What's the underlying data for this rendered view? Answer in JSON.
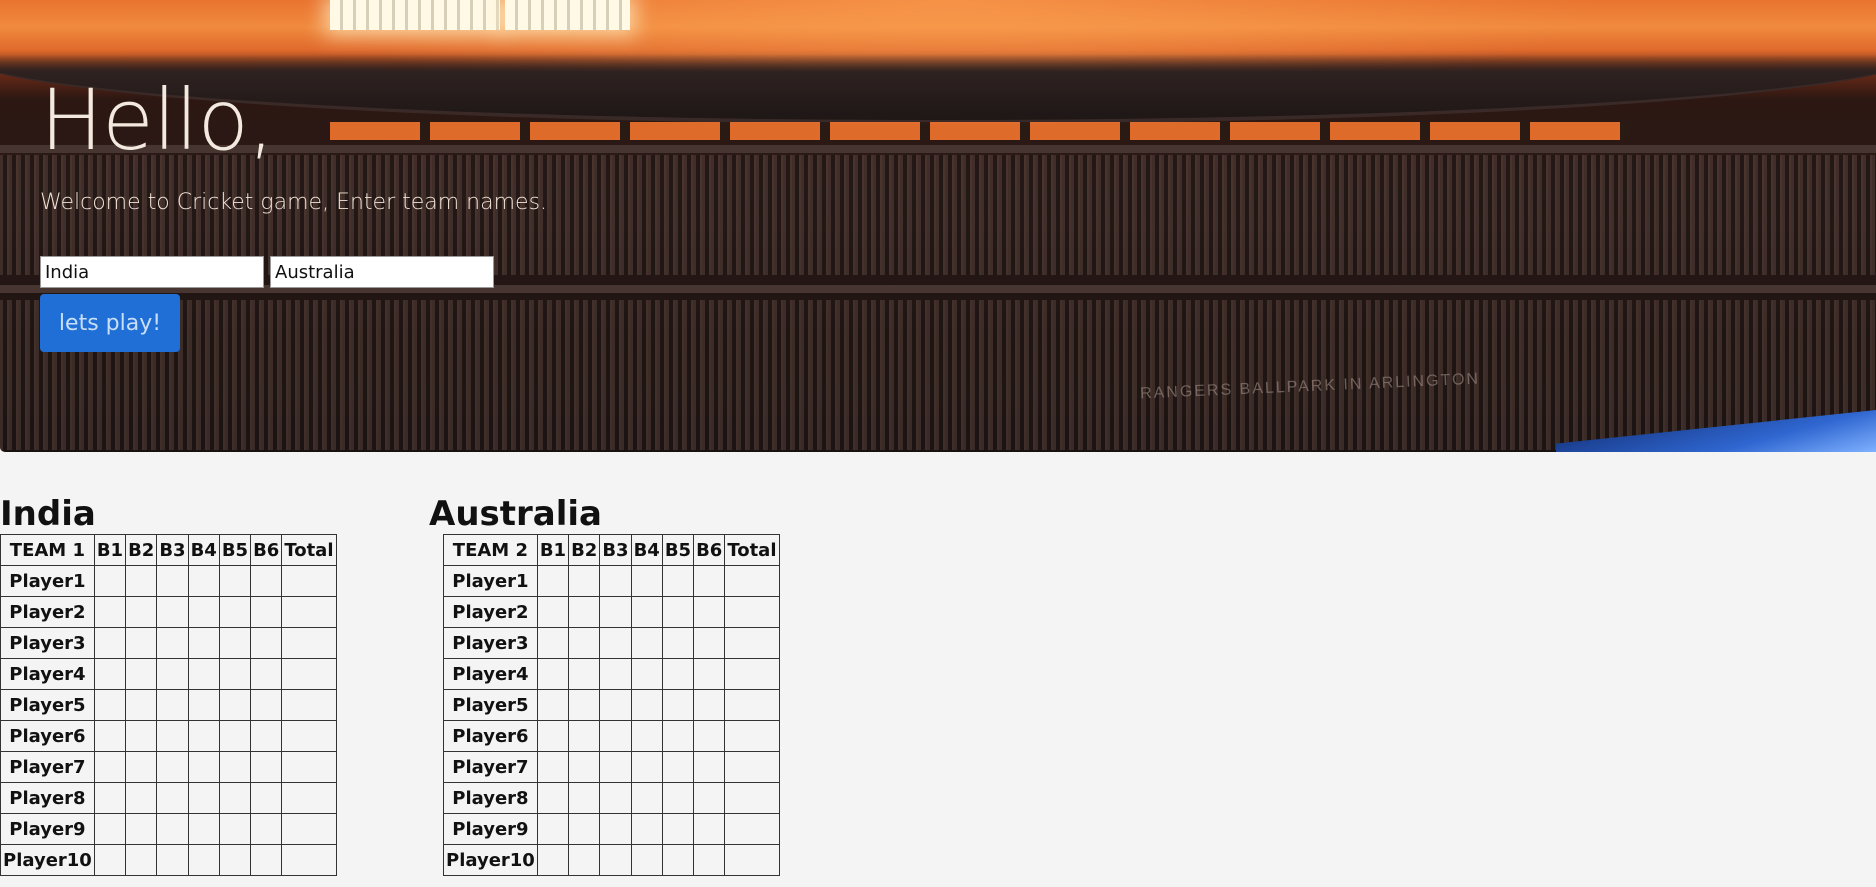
{
  "hero": {
    "greeting": "Hello,",
    "welcome": "Welcome to Cricket game, Enter team names.",
    "background_sign": "RANGERS BALLPARK IN ARLINGTON"
  },
  "form": {
    "team1_value": "India",
    "team2_value": "Australia",
    "play_label": "lets play!"
  },
  "teams": [
    {
      "name": "India",
      "header": [
        "TEAM 1",
        "B1",
        "B2",
        "B3",
        "B4",
        "B5",
        "B6",
        "Total"
      ],
      "players": [
        "Player1",
        "Player2",
        "Player3",
        "Player4",
        "Player5",
        "Player6",
        "Player7",
        "Player8",
        "Player9",
        "Player10"
      ]
    },
    {
      "name": "Australia",
      "header": [
        "TEAM 2",
        "B1",
        "B2",
        "B3",
        "B4",
        "B5",
        "B6",
        "Total"
      ],
      "players": [
        "Player1",
        "Player2",
        "Player3",
        "Player4",
        "Player5",
        "Player6",
        "Player7",
        "Player8",
        "Player9",
        "Player10"
      ]
    }
  ],
  "colors": {
    "button_bg": "#1f6fd6",
    "page_bg": "#f4f4f4",
    "sky": "#f08a3e"
  }
}
